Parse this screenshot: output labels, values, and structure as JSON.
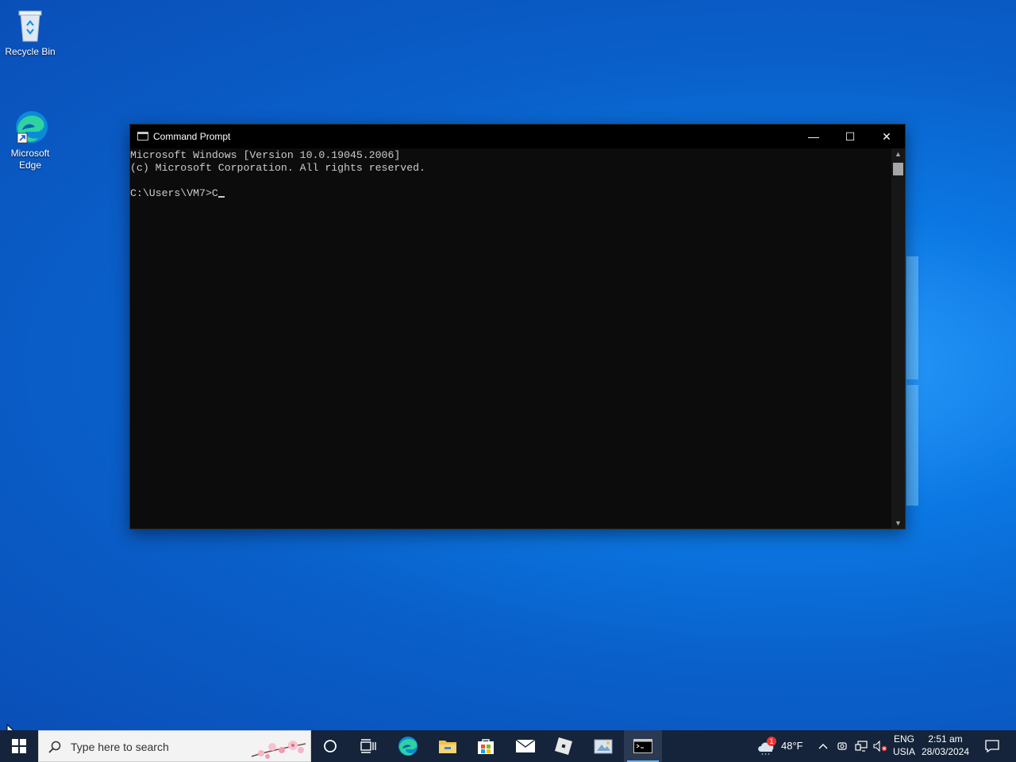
{
  "desktop": {
    "icons": [
      {
        "label": "Recycle Bin",
        "icon": "recycle-bin-icon"
      },
      {
        "label": "Microsoft\nEdge",
        "icon": "edge-icon"
      }
    ]
  },
  "window": {
    "title": "Command Prompt",
    "icon": "cmd-icon",
    "buttons": {
      "minimize": "—",
      "maximize": "☐",
      "close": "✕"
    },
    "console_lines": [
      "Microsoft Windows [Version 10.0.19045.2006]",
      "(c) Microsoft Corporation. All rights reserved.",
      "",
      "C:\\Users\\VM7>C"
    ]
  },
  "taskbar": {
    "search_placeholder": "Type here to search",
    "pinned": [
      {
        "name": "cortana",
        "icon": "cortana-circle-icon"
      },
      {
        "name": "task-view",
        "icon": "task-view-icon"
      },
      {
        "name": "edge",
        "icon": "edge-icon"
      },
      {
        "name": "file-explorer",
        "icon": "folder-icon"
      },
      {
        "name": "microsoft-store",
        "icon": "store-icon"
      },
      {
        "name": "mail",
        "icon": "mail-icon"
      },
      {
        "name": "roblox",
        "icon": "roblox-icon"
      },
      {
        "name": "paint",
        "icon": "paint-icon"
      },
      {
        "name": "command-prompt",
        "icon": "cmd-icon",
        "active": true
      }
    ],
    "tray": {
      "weather_badge": "1",
      "weather_temp": "48°F",
      "lang_line1": "ENG",
      "lang_line2": "USIA",
      "time": "2:51 am",
      "date": "28/03/2024"
    }
  }
}
